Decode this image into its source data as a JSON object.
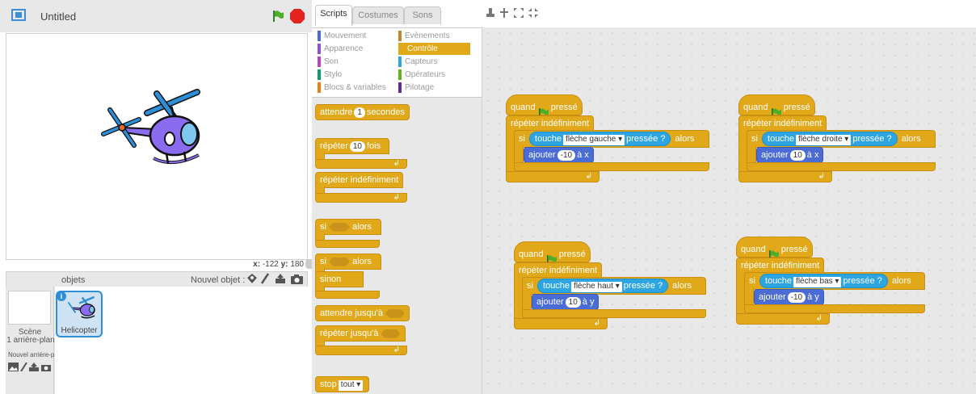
{
  "stage": {
    "title": "Untitled",
    "coords": {
      "x_label": "x:",
      "x_value": "-122",
      "y_label": "y:",
      "y_value": "180"
    }
  },
  "sprites": {
    "header_label": "objets",
    "new_sprite_label": "Nouvel objet :",
    "scene_label": "Scène",
    "backdrop_count": "1 arrière-plan",
    "new_backdrop_label": "Nouvel arrière-plan :",
    "sprite_name": "Helicopter",
    "info_label": "i"
  },
  "tabs": {
    "scripts": "Scripts",
    "costumes": "Costumes",
    "sounds": "Sons"
  },
  "categories": {
    "motion": "Mouvement",
    "looks": "Apparence",
    "sound": "Son",
    "pen": "Stylo",
    "data": "Blocs & variables",
    "events": "Evènements",
    "control": "Contrôle",
    "sensing": "Capteurs",
    "operators": "Opérateurs",
    "more": "Pilotage"
  },
  "palette": {
    "wait": "attendre",
    "wait_num": "1",
    "wait_unit": "secondes",
    "repeat": "répéter",
    "repeat_num": "10",
    "repeat_unit": "fois",
    "forever": "répéter indéfiniment",
    "if": "si",
    "then": "alors",
    "else": "sinon",
    "wait_until": "attendre jusqu'à",
    "repeat_until": "répéter jusqu'à",
    "stop": "stop",
    "stop_option": "tout"
  },
  "scripts": {
    "when": "quand",
    "clicked": "pressé",
    "forever": "répéter indéfiniment",
    "if": "si",
    "touch": "touche",
    "pressed": "pressée ?",
    "then": "alors",
    "add": "ajouter",
    "to": "à",
    "s1": {
      "key": "flèche gauche",
      "value": "-10",
      "axis": "x"
    },
    "s2": {
      "key": "flèche droite",
      "value": "10",
      "axis": "x"
    },
    "s3": {
      "key": "flèche haut",
      "value": "10",
      "axis": "y"
    },
    "s4": {
      "key": "flèche bas",
      "value": "-10",
      "axis": "y"
    }
  },
  "colors": {
    "control": "#e1a91a",
    "sensing": "#2ca5e2",
    "motion": "#4a6cd4",
    "events": "#c88330",
    "looks": "#8a55d7",
    "sound": "#bb42c3",
    "pen": "#0e9a6c",
    "data": "#ee7d16",
    "operators": "#5cb712",
    "more": "#632d99",
    "selected_control": "#e1a91a"
  }
}
